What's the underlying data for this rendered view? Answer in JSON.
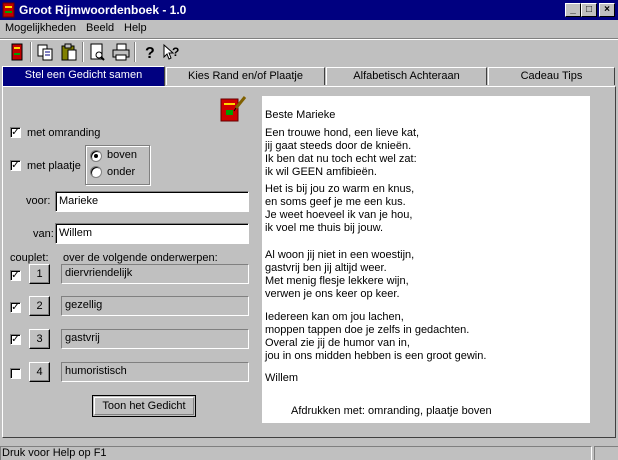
{
  "window": {
    "title": "Groot Rijmwoordenboek - 1.0",
    "minimize": "_",
    "maximize": "□",
    "close": "×"
  },
  "menu": [
    {
      "label": "Mogelijkheden"
    },
    {
      "label": "Beeld"
    },
    {
      "label": "Help"
    }
  ],
  "toolbar": [
    "book-icon",
    "copy-icon",
    "paste-icon",
    "print-preview-icon",
    "print-icon",
    "help-icon",
    "context-help-icon"
  ],
  "tabs": [
    {
      "label": "Stel een Gedicht samen",
      "active": true
    },
    {
      "label": "Kies Rand en/of Plaatje"
    },
    {
      "label": "Alfabetisch Achteraan"
    },
    {
      "label": "Cadeau Tips"
    }
  ],
  "options": {
    "border_label": "met omranding",
    "border_checked": "✓",
    "picture_label": "met plaatje",
    "picture_checked": "✓",
    "pos_top": "boven",
    "pos_bottom": "onder"
  },
  "fields": {
    "for_label": "voor:",
    "for_value": "Marieke",
    "from_label": "van:",
    "from_value": "Willem"
  },
  "couplets": {
    "header_left": "couplet:",
    "header_right": "over de volgende onderwerpen:",
    "rows": [
      {
        "checked": "✓",
        "num": "1",
        "topic": "diervriendelijk"
      },
      {
        "checked": "✓",
        "num": "2",
        "topic": "gezellig"
      },
      {
        "checked": "✓",
        "num": "3",
        "topic": "gastvrij"
      },
      {
        "checked": "",
        "num": "4",
        "topic": "humoristisch"
      }
    ]
  },
  "show_button": "Toon het Gedicht",
  "poem": {
    "greeting": "Beste Marieke",
    "lines": [
      "Een trouwe hond, een lieve kat,",
      "jij gaat steeds door de knieën.",
      "Ik ben dat nu toch echt wel zat:",
      "ik wil GEEN amfibieën.",
      "Het is bij jou zo warm en knus,",
      "en soms geef je me een kus.",
      "Je weet hoeveel ik van je hou,",
      "ik voel me thuis bij jouw.",
      "Al woon jij niet in een woestijn,",
      "gastvrij ben jij altijd weer.",
      "Met menig flesje lekkere wijn,",
      "verwen je ons keer op keer.",
      "Iedereen kan om jou lachen,",
      "moppen tappen doe je zelfs in gedachten.",
      "Overal zie jij de humor van in,",
      "jou in ons midden hebben is een groot gewin."
    ],
    "signature": "Willem",
    "footer": "Afdrukken met: omranding, plaatje boven"
  },
  "status": "Druk voor Help op  F1",
  "colors": {
    "titlebar": "#000080",
    "face": "#c0c0c0"
  }
}
